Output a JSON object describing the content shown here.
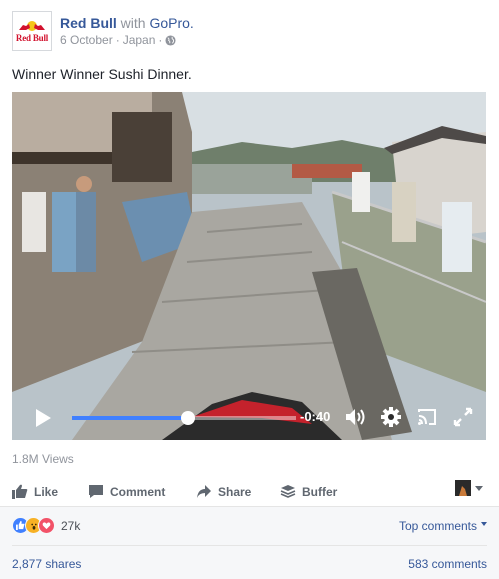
{
  "post": {
    "page_name": "Red Bull",
    "with_text": "with",
    "partner": "GoPro.",
    "date": "6 October",
    "separator": "·",
    "location": "Japan",
    "avatar_wordmark": "Red Bull",
    "caption": "Winner Winner Sushi Dinner."
  },
  "video": {
    "remaining_time": "-0:40",
    "progress": 0.52,
    "icons": [
      "play-icon",
      "volume-icon",
      "settings-icon",
      "cast-icon",
      "fullscreen-icon"
    ]
  },
  "stats": {
    "views": "1.8M Views",
    "reaction_count": "27k",
    "shares": "2,877 shares",
    "comments": "583 comments",
    "top_comments_label": "Top comments"
  },
  "actions": {
    "like": "Like",
    "comment": "Comment",
    "share": "Share",
    "buffer": "Buffer"
  },
  "colors": {
    "link": "#365899",
    "muted": "#90949c",
    "action": "#606770",
    "progress": "#4080ff",
    "like_blue": "#4080ff",
    "wow_yellow": "#f7b125",
    "love_red": "#f25268",
    "brand_red": "#d2122e"
  }
}
